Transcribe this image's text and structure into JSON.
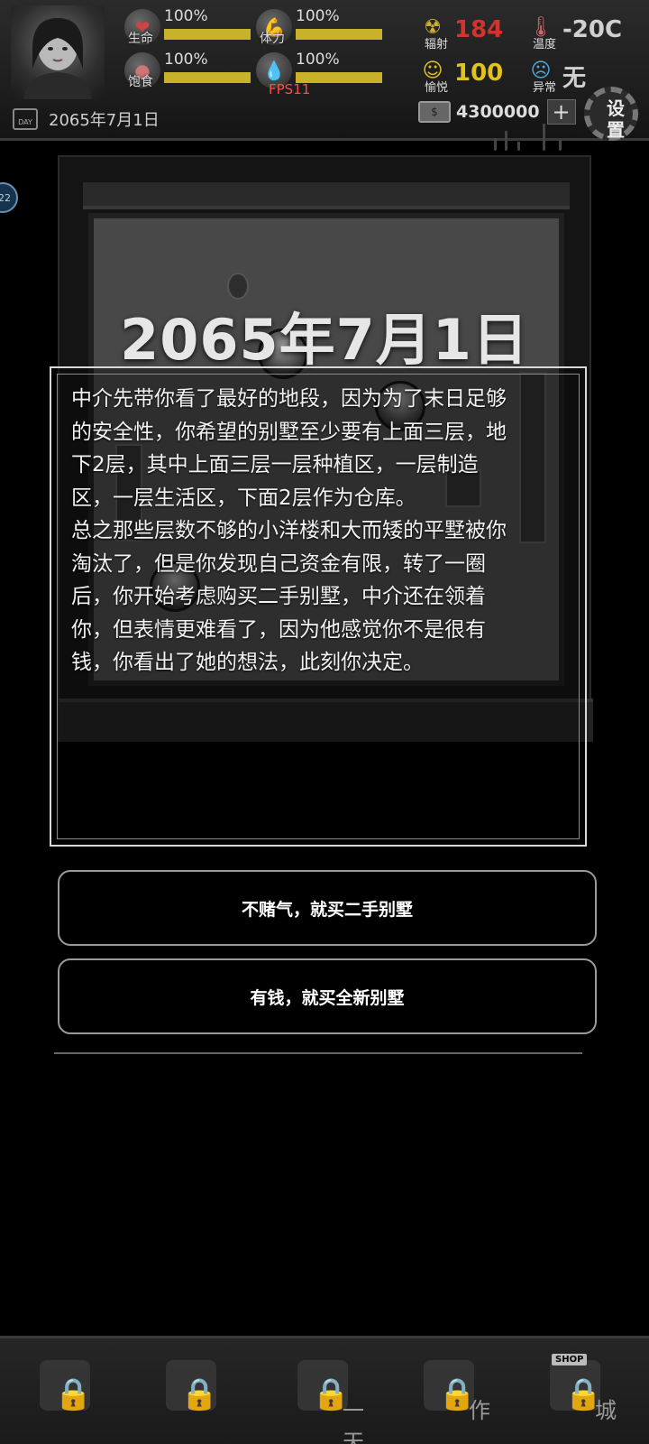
{
  "hud": {
    "stats": [
      {
        "label": "生命",
        "pct": "100%",
        "icon": "heart-icon",
        "level": 1.0
      },
      {
        "label": "体力",
        "pct": "100%",
        "icon": "muscle-icon",
        "level": 1.0
      },
      {
        "label": "饱食",
        "pct": "100%",
        "icon": "stomach-icon",
        "level": 1.0
      },
      {
        "label": "",
        "pct": "100%",
        "icon": "water-drop-icon",
        "level": 1.0
      }
    ],
    "fps": "FPS11",
    "date": "2065年7月1日",
    "day_icon_text": "DAY",
    "radiation": {
      "label": "辐射",
      "value": "184",
      "color": "#d2342c"
    },
    "temperature": {
      "label": "温度",
      "value": "-20C",
      "color": "#d0d0d0"
    },
    "joy": {
      "label": "愉悦",
      "value": "100",
      "color": "#e2c21e"
    },
    "abnormal": {
      "label": "异常",
      "value": "无",
      "color": "#d0d0d0"
    },
    "money": "4300000",
    "money_plus": "+",
    "settings_label": "设置",
    "side_badge": "22"
  },
  "scene": {
    "date_title": "2065年7月1日"
  },
  "story": {
    "text": "中介先带你看了最好的地段，因为为了末日足够\n的安全性，你希望的别墅至少要有上面三层，地\n下2层，其中上面三层一层种植区，一层制造\n区，一层生活区，下面2层作为仓库。\n总之那些层数不够的小洋楼和大而矮的平墅被你\n淘汰了，但是你发现自己资金有限，转了一圈\n后，你开始考虑购买二手别墅，中介还在领着\n你，但表情更难看了，因为他感觉你不是很有\n钱，你看出了她的想法，此刻你决定。"
  },
  "choices": [
    {
      "label": "不赌气，就买二手别墅"
    },
    {
      "label": "有钱，就买全新别墅"
    }
  ],
  "bottom_nav": [
    {
      "label": "",
      "locked": true
    },
    {
      "label": "",
      "locked": true
    },
    {
      "label": "一天",
      "locked": true
    },
    {
      "label": "作",
      "locked": true
    },
    {
      "label": "城",
      "locked": true
    }
  ],
  "shop_tag": "SHOP"
}
